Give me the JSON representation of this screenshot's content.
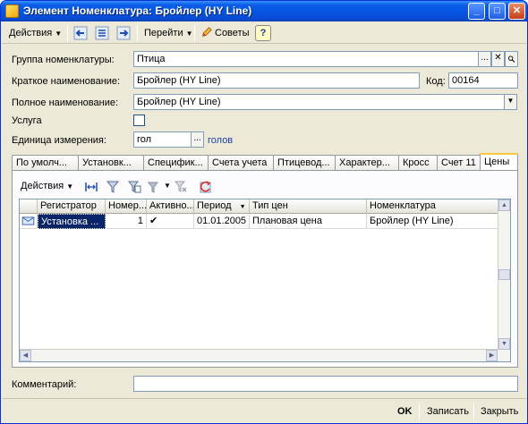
{
  "window": {
    "title": "Элемент Номенклатура: Бройлер (HY Line)",
    "controls": {
      "minimize": "_",
      "maximize": "□",
      "close": "✕"
    }
  },
  "toolbar": {
    "actions_label": "Действия",
    "goto_label": "Перейти",
    "tips_label": "Советы",
    "help_label": "?"
  },
  "form": {
    "group": {
      "label": "Группа номенклатуры:",
      "value": "Птица"
    },
    "short_name": {
      "label": "Краткое наименование:",
      "value": "Бройлер (HY Line)"
    },
    "code": {
      "label": "Код:",
      "value": "00164"
    },
    "full_name": {
      "label": "Полное наименование:",
      "value": "Бройлер (HY Line)"
    },
    "service": {
      "label": "Услуга",
      "checked": false
    },
    "unit": {
      "label": "Единица измерения:",
      "value": "гол",
      "link": "голов"
    },
    "ellipsis": "...",
    "clear": "✕",
    "search": "🔍",
    "dropdown": "▼"
  },
  "tabs": [
    {
      "label": "По умолч..."
    },
    {
      "label": "Установк..."
    },
    {
      "label": "Специфик..."
    },
    {
      "label": "Счета учета"
    },
    {
      "label": "Птицевод..."
    },
    {
      "label": "Характер..."
    },
    {
      "label": "Кросс"
    },
    {
      "label": "Счет 11"
    },
    {
      "label": "Цены",
      "active": true
    }
  ],
  "panel": {
    "actions_label": "Действия"
  },
  "grid": {
    "columns": [
      {
        "label": "Регистратор"
      },
      {
        "label": "Номер..."
      },
      {
        "label": "Активно..."
      },
      {
        "label": "Период"
      },
      {
        "label": "Тип цен"
      },
      {
        "label": "Номенклатура"
      }
    ],
    "rows": [
      {
        "registrar": "Установка ...",
        "number": "1",
        "active": "✔",
        "period": "01.01.2005",
        "price_type": "Плановая цена",
        "item": "Бройлер (HY Line)"
      }
    ]
  },
  "comment": {
    "label": "Комментарий:",
    "value": ""
  },
  "buttons": {
    "ok": "OK",
    "save": "Записать",
    "close": "Закрыть"
  },
  "colors": {
    "title_bar": "#0554e3",
    "selection": "#0a246a",
    "active_tab": "#ffc83c",
    "link": "#1f3fa8"
  }
}
